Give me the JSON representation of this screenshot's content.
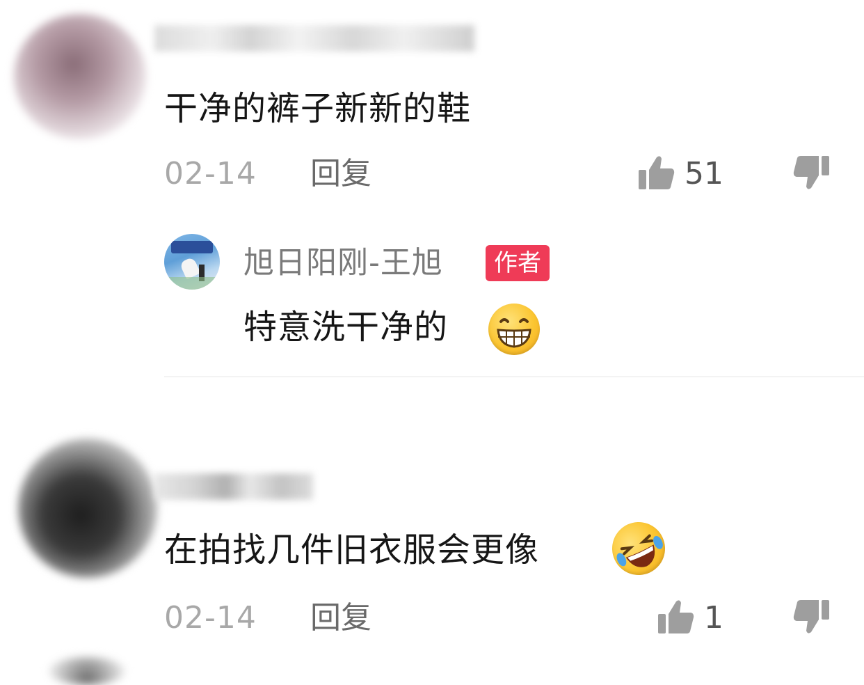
{
  "comments": [
    {
      "text": "干净的裤子新新的鞋",
      "date": "02-14",
      "reply_label": "回复",
      "like_count": "51",
      "replies": [
        {
          "author": "旭日阳刚-王旭",
          "badge": "作者",
          "text": "特意洗干净的",
          "emoji": "grinning-emoji"
        }
      ]
    },
    {
      "text": "在拍找几件旧衣服会更像",
      "emoji": "rolling-laughing-emoji",
      "date": "02-14",
      "reply_label": "回复",
      "like_count": "1"
    }
  ],
  "colors": {
    "badge": "#ef3b57",
    "meta": "#a8a8a8",
    "icon": "#9e9e9e"
  },
  "icons": [
    "thumbs-up-icon",
    "thumbs-down-icon"
  ]
}
